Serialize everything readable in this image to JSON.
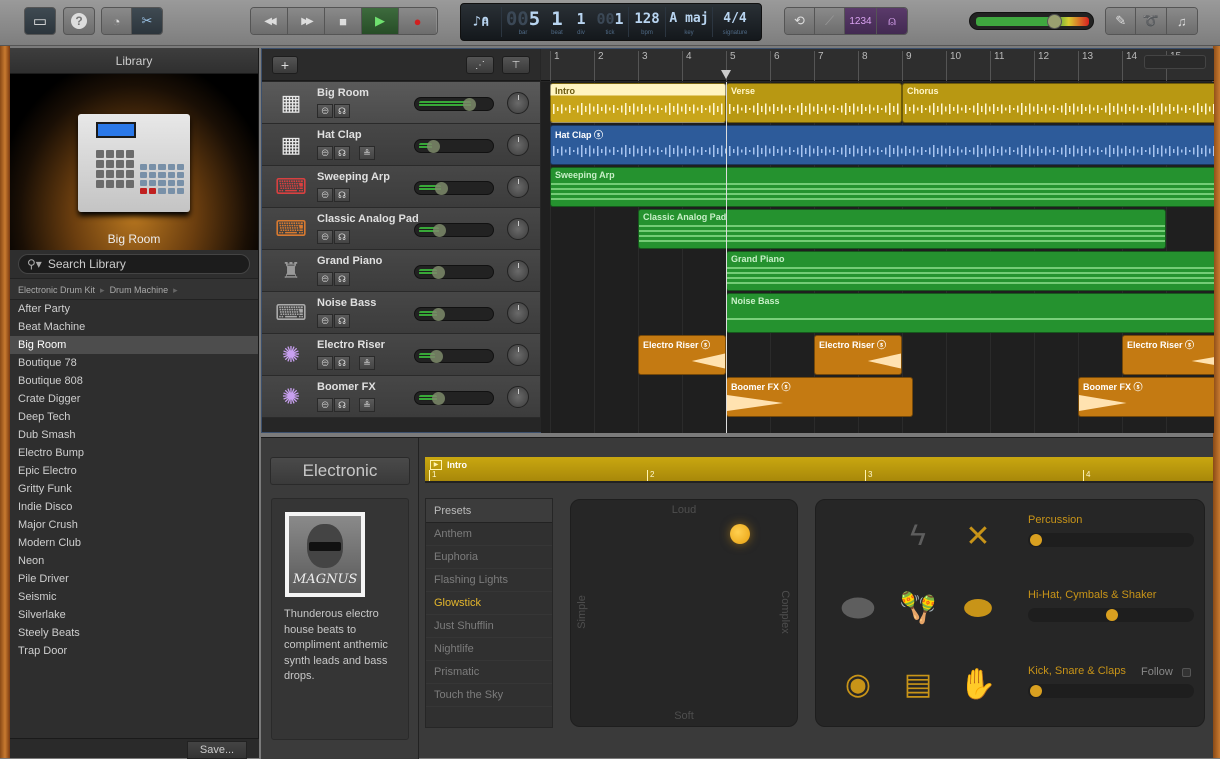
{
  "toolbar": {
    "library_btn": "library-icon",
    "help_btn": "?",
    "smart_controls_btn": "smart-controls-icon",
    "editors_btn": "scissors-icon",
    "transport": {
      "rewind": "◀◀",
      "forward": "▶▶",
      "stop": "■",
      "play": "▶",
      "record": "●"
    },
    "lcd": {
      "bar": "5",
      "bar_dim": "00",
      "bar_label": "bar",
      "beat": "1",
      "beat_label": "beat",
      "div": "1",
      "div_label": "div",
      "tick": "1",
      "tick_dim": "00",
      "tick_label": "tick",
      "bpm": "128",
      "bpm_label": "bpm",
      "key": "A maj",
      "key_label": "key",
      "signature": "4/4",
      "signature_label": "signature"
    },
    "cycle_btn": "⟲",
    "tuner_btn": "tuner-icon",
    "count_in_label": "1234",
    "metronome_btn": "metronome-icon",
    "master_volume": 0.68,
    "notepad_btn": "notepad-icon",
    "loops_btn": "loop-icon",
    "media_btn": "media-browser-icon"
  },
  "library": {
    "title": "Library",
    "hero_name": "Big Room",
    "search_placeholder": "Search Library",
    "breadcrumb": [
      "Electronic Drum Kit",
      "Drum Machine"
    ],
    "items": [
      "After Party",
      "Beat Machine",
      "Big Room",
      "Boutique 78",
      "Boutique 808",
      "Crate Digger",
      "Deep Tech",
      "Dub Smash",
      "Electro Bump",
      "Epic Electro",
      "Gritty Funk",
      "Indie Disco",
      "Major Crush",
      "Modern Club",
      "Neon",
      "Pile Driver",
      "Seismic",
      "Silverlake",
      "Steely Beats",
      "Trap Door"
    ],
    "selected": "Big Room",
    "save_label": "Save..."
  },
  "tracks": {
    "add_label": "+",
    "list": [
      {
        "name": "Big Room",
        "icon": "drum-machine-icon",
        "volume": 0.72,
        "has_extra": false,
        "selected": true
      },
      {
        "name": "Hat Clap",
        "icon": "drum-machine-icon",
        "volume": 0.18,
        "has_extra": true,
        "selected": false
      },
      {
        "name": "Sweeping Arp",
        "icon": "synth-keyboard-icon",
        "volume": 0.3,
        "has_extra": false,
        "selected": false
      },
      {
        "name": "Classic Analog Pad",
        "icon": "analog-synth-icon",
        "volume": 0.28,
        "has_extra": false,
        "selected": false
      },
      {
        "name": "Grand Piano",
        "icon": "grand-piano-icon",
        "volume": 0.25,
        "has_extra": false,
        "selected": false
      },
      {
        "name": "Noise Bass",
        "icon": "keyboard-stand-icon",
        "volume": 0.25,
        "has_extra": false,
        "selected": false
      },
      {
        "name": "Electro Riser",
        "icon": "fx-burst-icon",
        "volume": 0.22,
        "has_extra": true,
        "selected": false
      },
      {
        "name": "Boomer FX",
        "icon": "fx-burst-icon",
        "volume": 0.25,
        "has_extra": true,
        "selected": false
      }
    ]
  },
  "ruler": {
    "bars": [
      "1",
      "2",
      "3",
      "4",
      "5",
      "6",
      "7",
      "8",
      "9",
      "10",
      "11",
      "12",
      "13",
      "14",
      "15"
    ],
    "playhead_bar": 5
  },
  "regions": [
    {
      "track": 0,
      "name": "Intro",
      "start": 1,
      "end": 5,
      "color": "yellow",
      "selected": true
    },
    {
      "track": 0,
      "name": "Verse",
      "start": 5,
      "end": 9,
      "color": "yellow"
    },
    {
      "track": 0,
      "name": "Chorus",
      "start": 9,
      "end": 16.6,
      "color": "yellow"
    },
    {
      "track": 1,
      "name": "Hat Clap",
      "start": 1,
      "end": 16.6,
      "color": "blue",
      "loop": true
    },
    {
      "track": 2,
      "name": "Sweeping Arp",
      "start": 1,
      "end": 16.6,
      "color": "green",
      "kind": "midi"
    },
    {
      "track": 3,
      "name": "Classic Analog Pad",
      "start": 3,
      "end": 15,
      "color": "green",
      "kind": "midi"
    },
    {
      "track": 4,
      "name": "Grand Piano",
      "start": 5,
      "end": 16.6,
      "color": "green",
      "kind": "midi"
    },
    {
      "track": 5,
      "name": "Noise Bass",
      "start": 5,
      "end": 16.6,
      "color": "green",
      "kind": "bass"
    },
    {
      "track": 6,
      "name": "Electro Riser",
      "start": 3,
      "end": 5,
      "color": "orange",
      "loop": true,
      "kind": "riser"
    },
    {
      "track": 6,
      "name": "Electro Riser",
      "start": 7,
      "end": 9,
      "color": "orange",
      "loop": true,
      "kind": "riser"
    },
    {
      "track": 6,
      "name": "Electro Riser",
      "start": 14,
      "end": 16.6,
      "color": "orange",
      "loop": true,
      "kind": "riser"
    },
    {
      "track": 7,
      "name": "Boomer FX",
      "start": 5,
      "end": 9.25,
      "color": "orange",
      "loop": true,
      "kind": "boom"
    },
    {
      "track": 7,
      "name": "Boomer FX",
      "start": 13,
      "end": 16.6,
      "color": "orange",
      "loop": true,
      "kind": "boom"
    }
  ],
  "editor": {
    "genre": "Electronic",
    "drummer_signature": "MAGNUS",
    "description": "Thunderous electro house beats to compliment anthemic synth leads and bass drops.",
    "region_name": "Intro",
    "region_beats": [
      "1",
      "2",
      "3",
      "4"
    ],
    "presets_header": "Presets",
    "presets": [
      "Anthem",
      "Euphoria",
      "Flashing Lights",
      "Glowstick",
      "Just Shufflin",
      "Nightlife",
      "Prismatic",
      "Touch the Sky"
    ],
    "selected_preset": "Glowstick",
    "xy": {
      "top": "Loud",
      "bottom": "Soft",
      "left": "Simple",
      "right": "Complex",
      "complexity": 0.74,
      "loudness": 0.85
    },
    "kit": {
      "percussion_label": "Percussion",
      "percussion_value": 0.0,
      "hihat_label": "Hi-Hat, Cymbals & Shaker",
      "hihat_value": 0.5,
      "kick_label": "Kick, Snare & Claps",
      "kick_value": 0.0,
      "follow_label": "Follow"
    },
    "accent_color": "#c89418"
  }
}
